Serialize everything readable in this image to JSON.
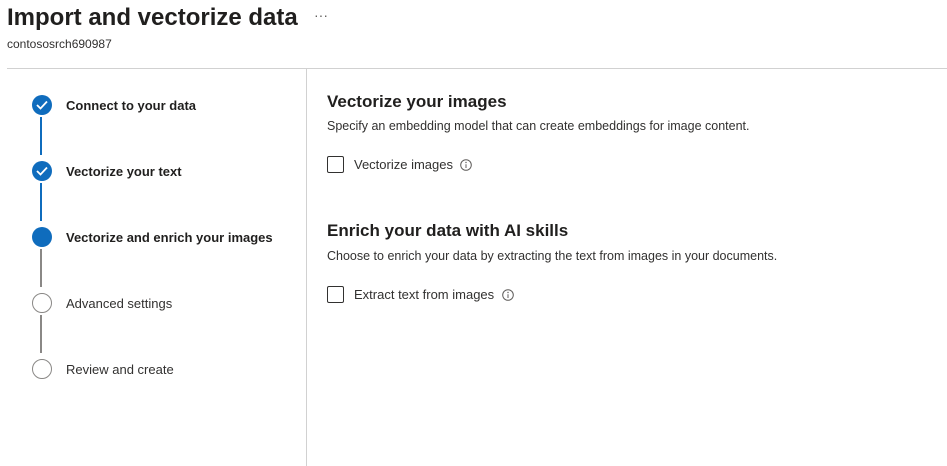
{
  "header": {
    "title": "Import and vectorize data",
    "more_label": "···",
    "subtitle": "contososrch690987"
  },
  "steps": [
    {
      "label": "Connect to your data",
      "state": "done"
    },
    {
      "label": "Vectorize your text",
      "state": "done"
    },
    {
      "label": "Vectorize and enrich your images",
      "state": "current"
    },
    {
      "label": "Advanced settings",
      "state": "pending"
    },
    {
      "label": "Review and create",
      "state": "pending"
    }
  ],
  "vectorize_section": {
    "title": "Vectorize your images",
    "description": "Specify an embedding model that can create embeddings for image content.",
    "checkbox_label": "Vectorize images",
    "checked": false
  },
  "enrich_section": {
    "title": "Enrich your data with AI skills",
    "description": "Choose to enrich your data by extracting the text from images in your documents.",
    "checkbox_label": "Extract text from images",
    "checked": false
  },
  "colors": {
    "accent": "#0f6cbd",
    "pending": "#8a8886",
    "divider": "#d1d1d1"
  },
  "icons": {
    "more": "more-icon",
    "check": "checkmark-icon",
    "info": "info-icon"
  }
}
